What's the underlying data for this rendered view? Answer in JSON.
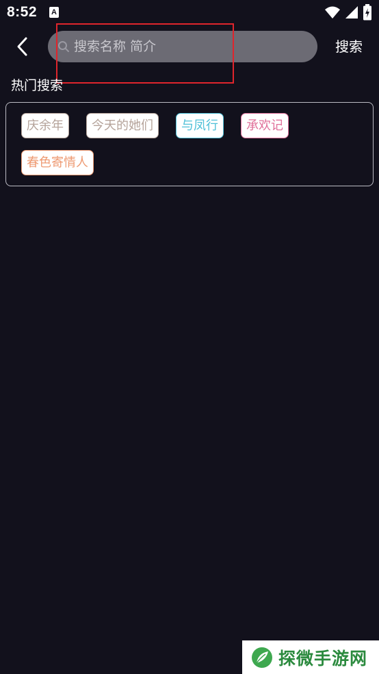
{
  "status_bar": {
    "time": "8:52",
    "notification_letter": "A"
  },
  "header": {
    "search_placeholder": "搜索名称 简介",
    "search_value": "",
    "search_button_label": "搜索"
  },
  "hot_search": {
    "title": "热门搜索",
    "tags": [
      {
        "label": "庆余年",
        "color": "#b5a39a"
      },
      {
        "label": "今天的她们",
        "color": "#b5a39a"
      },
      {
        "label": "与凤行",
        "color": "#4fc0d8"
      },
      {
        "label": "承欢记",
        "color": "#e0709a"
      },
      {
        "label": "春色寄情人",
        "color": "#ee9a72"
      }
    ]
  },
  "watermark": {
    "text": "探微手游网"
  },
  "colors": {
    "background": "#12111c",
    "search_box": "#6c6b74",
    "highlight": "#e0252c",
    "watermark_green": "#2b8a3e"
  }
}
